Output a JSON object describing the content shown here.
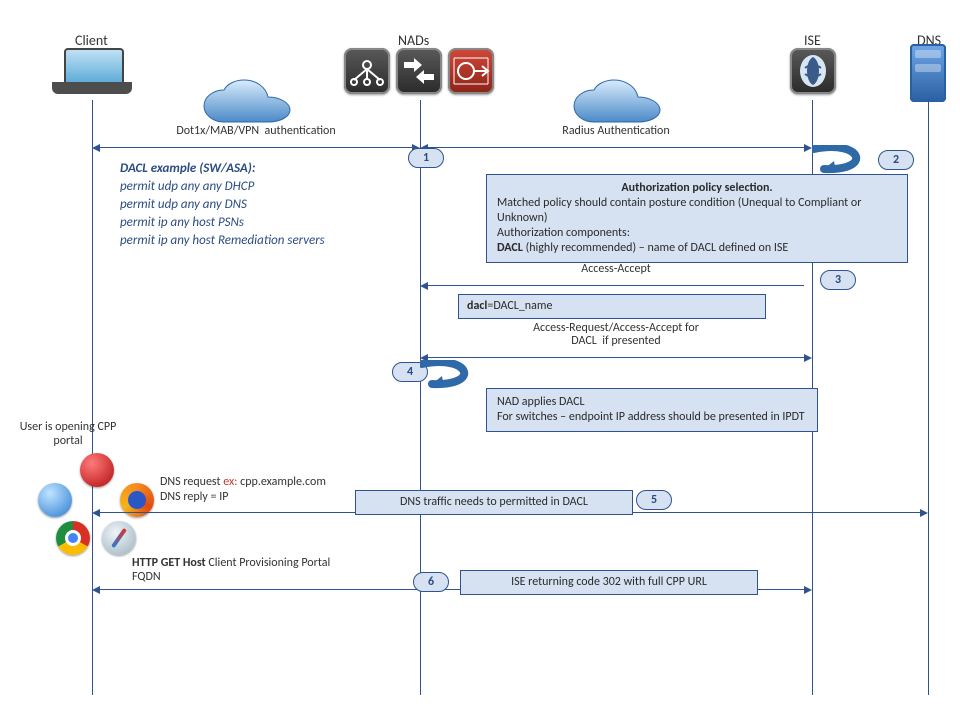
{
  "heads": {
    "client": "Client",
    "nads": "NADs",
    "ise": "ISE",
    "dns": "DNS"
  },
  "cloud_left_alt": "cloud-between-client-nad",
  "cloud_right_alt": "cloud-between-nad-ise",
  "messages": {
    "m1": {
      "label": "Dot1x/MAB/VPN  authentication"
    },
    "m1b": {
      "label": "Radius Authentication"
    },
    "m3": {
      "label": "Access-Accept"
    },
    "m3b": {
      "label": "Access-Request/Access-Accept for\nDACL  if presented"
    },
    "m5": {
      "label": "DNS traffic needs to permitted  in DACL"
    },
    "m6": {
      "label1": "HTTP GET Host ",
      "label2": "Client Provisioning Portal\nFQDN"
    },
    "dns_req": {
      "label_pre": "DNS request ",
      "ex": "ex: ",
      "host": "cpp.example.com"
    },
    "dns_reply": "DNS reply = IP"
  },
  "badges": {
    "b1": "1",
    "b2": "2",
    "b3": "3",
    "b4": "4",
    "b5": "5",
    "b6": "6"
  },
  "dacl_example": {
    "title": "DACL example (SW/ASA):",
    "l1": "permit udp any any  DHCP",
    "l2": "permit udp any any DNS",
    "l3": "permit ip any host PSNs",
    "l4": "permit ip any host Remediation servers"
  },
  "notes": {
    "authz": {
      "title": "Authorization  policy selection.",
      "l1": "Matched policy should contain posture condition (Unequal to Compliant or Unknown)",
      "l2": "Authorization components:",
      "l3a": "DACL ",
      "l3b": "(highly recommended) – name of DACL defined on ISE"
    },
    "dacl_val": {
      "label": "dacl",
      "eq": "=DACL_name"
    },
    "nad_applies": {
      "l1": "NAD applies DACL",
      "l2": "For switches – endpoint IP address should be presented  in IPDT"
    },
    "ise302": "ISE returning code 302 with full CPP URL"
  },
  "side": {
    "cpp": "User is opening CPP portal"
  }
}
